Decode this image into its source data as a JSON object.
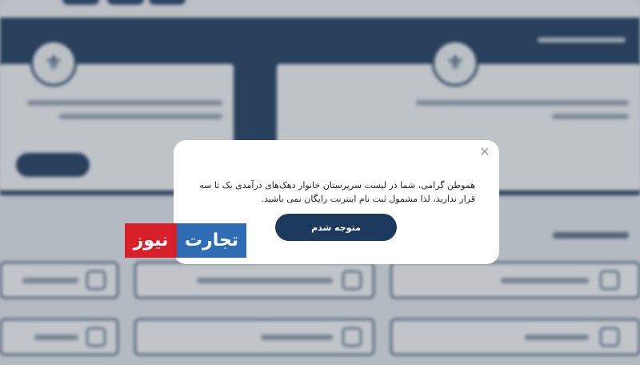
{
  "modal": {
    "message": "هموطن گرامی، شما در لیست سرپرستان خانوار دهک‌های درآمدی یک تا سه قرار ندارید، لذا مشمول ثبت نام اینترنت رایگان نمی باشید.",
    "confirm_label": "متوجه شدم",
    "close_glyph": "✕"
  },
  "watermark": {
    "part_red": "نیوز",
    "part_blue": "تجارت"
  },
  "colors": {
    "primary": "#1c3a5c",
    "logo_red": "#d7202a",
    "logo_blue": "#2e6db3"
  }
}
